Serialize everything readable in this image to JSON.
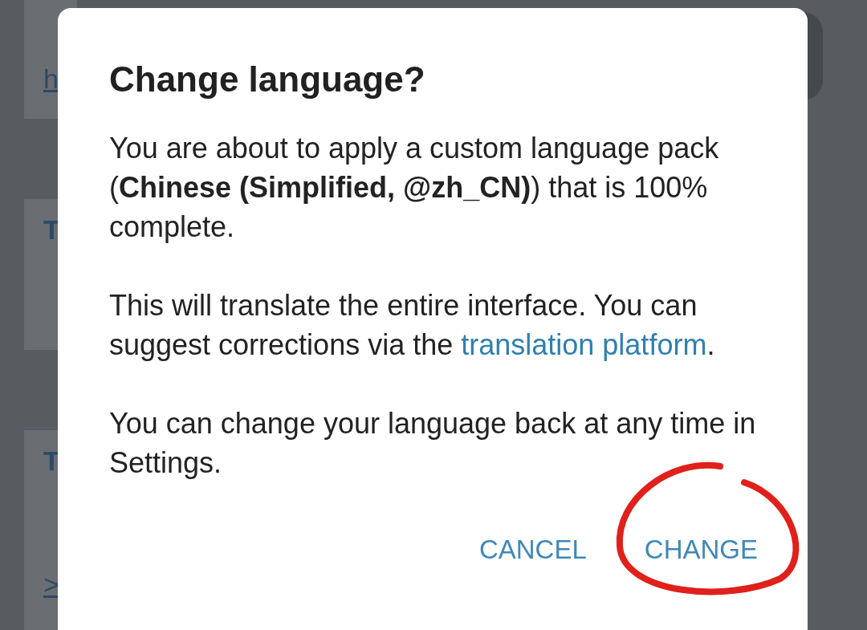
{
  "background": {
    "bubbles": [
      {
        "lines": [
          {
            "kind": "link",
            "text": "h"
          }
        ]
      },
      {
        "lines": [
          {
            "kind": "sender",
            "text": "T"
          }
        ]
      },
      {
        "lines": [
          {
            "kind": "sender",
            "text": "T"
          },
          {
            "kind": "link",
            "text": ">"
          }
        ]
      }
    ]
  },
  "dialog": {
    "title": "Change language?",
    "paragraphs": [
      {
        "text": "You are about to apply a custom language pack (**Chinese (Simplified, @zh_CN)**) that is 100% complete."
      },
      {
        "text": "This will translate the entire interface. You can suggest corrections via the ",
        "link": "translation platform",
        "after": "."
      },
      {
        "text": "You can change your language back at any time in Settings."
      }
    ],
    "buttons": [
      {
        "label": "CANCEL",
        "highlighted": false
      },
      {
        "label": "CHANGE",
        "highlighted": true
      }
    ]
  }
}
